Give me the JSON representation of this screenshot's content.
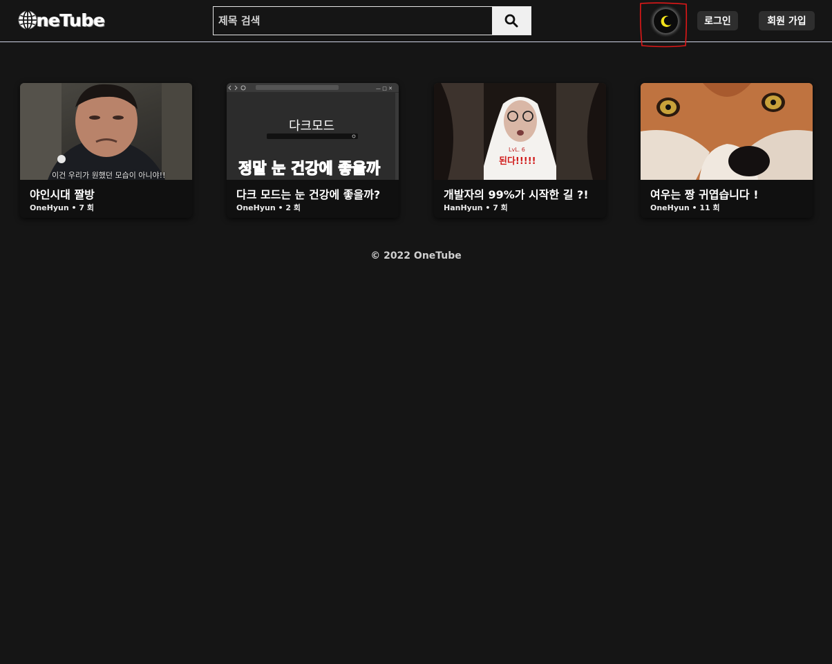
{
  "header": {
    "logo_text": "neTube",
    "search_placeholder": "제목 검색",
    "login_label": "로그인",
    "signup_label": "회원 가입",
    "icons": {
      "logo": "globe-icon",
      "search": "search-icon",
      "theme": "moon-icon"
    }
  },
  "videos": [
    {
      "title": "야인시대 짤방",
      "meta": "OneHyun • 7 회",
      "thumb_caption": "이건 우리가 원했던 모습이 아니야!!"
    },
    {
      "title": "다크 모드는 눈 건강에 좋을까?",
      "meta": "OneHyun • 2 회",
      "thumb_heading": "다크모드",
      "thumb_caption": "정말 눈 건강에 좋을까"
    },
    {
      "title": "개발자의 99%가 시작한 길 ?!",
      "meta": "HanHyun • 7 회",
      "thumb_caption": "된다!!!!!",
      "thumb_small": "LvL. 6"
    },
    {
      "title": "여우는 짱 귀엽습니다 !",
      "meta": "OneHyun • 11 회"
    }
  ],
  "footer": {
    "copyright": "© 2022 OneTube"
  },
  "colors": {
    "background": "#151515",
    "moon": "#f2e21b",
    "annotation": "#e01818"
  }
}
